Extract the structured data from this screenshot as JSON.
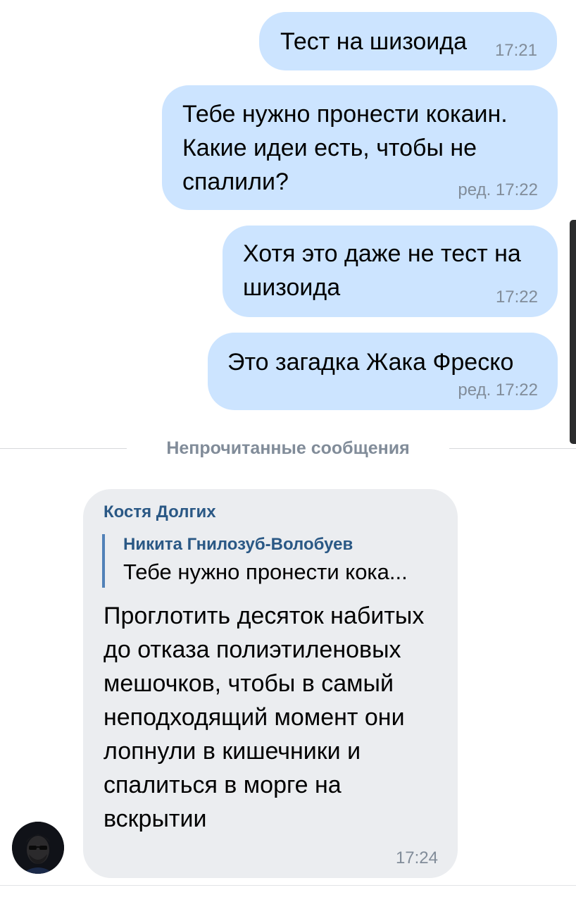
{
  "messages": {
    "m1": {
      "text": "Тест на шизоида",
      "time": "17:21"
    },
    "m2": {
      "text": "Тебе нужно пронести кокаин. Какие идеи есть, чтобы не спалили?",
      "time": "ред. 17:22"
    },
    "m3": {
      "text": "Хотя это даже не тест на шизоида",
      "time": "17:22"
    },
    "m4": {
      "text": "Это загадка Жака Фреско",
      "time": "ред. 17:22"
    }
  },
  "divider": {
    "label": "Непрочитанные сообщения"
  },
  "incoming": {
    "sender": "Костя Долгих",
    "reply": {
      "author": "Никита Гнилозуб-Волобуев",
      "text": "Тебе нужно пронести кока..."
    },
    "text": "Проглотить десяток набитых до отказа полиэтиленовых мешочков, чтобы в самый неподходящий момент они лопнули в кишечники и спалиться в морге на вскрытии",
    "time": "17:24"
  },
  "colors": {
    "outgoing_bubble": "#cce4ff",
    "incoming_bubble": "#ebedf0",
    "link": "#2a5885",
    "timestamp": "#818c99"
  }
}
